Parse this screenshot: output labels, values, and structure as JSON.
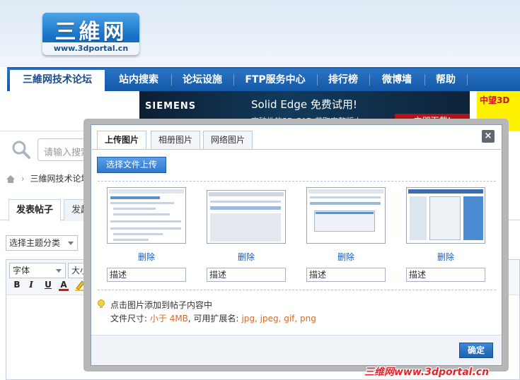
{
  "site": {
    "logo_cn": "三維网",
    "logo_url": "www.3dportal.cn"
  },
  "nav": {
    "items": [
      {
        "label": "三維网技术论坛",
        "active": true
      },
      {
        "label": "站内搜索"
      },
      {
        "label": "论坛设施"
      },
      {
        "label": "FTP服务中心"
      },
      {
        "label": "排行榜"
      },
      {
        "label": "微博墙"
      },
      {
        "label": "帮助"
      }
    ]
  },
  "banner": {
    "brand": "SIEMENS",
    "promo": "Solid Edge 免费试用!",
    "promo_sub": "突破性的3D CAD 获取完整版本",
    "cta": "立即下载!",
    "side_brand": "中望3D"
  },
  "search": {
    "placeholder": "请输入搜索"
  },
  "breadcrumb": {
    "current": "三維网技术论坛"
  },
  "post_tabs": [
    {
      "label": "发表帖子"
    },
    {
      "label": "发起"
    }
  ],
  "form": {
    "topic_select": "选择主题分类",
    "font_select": "字体",
    "size_select": "大小",
    "fmt_bold": "B",
    "fmt_italic": "I",
    "fmt_underline": "U",
    "fmt_color": "A"
  },
  "dialog": {
    "tabs": [
      {
        "label": "上传图片",
        "active": true
      },
      {
        "label": "相册图片"
      },
      {
        "label": "网络图片"
      }
    ],
    "close": "×",
    "upload_button": "选择文件上传",
    "images": [
      {
        "delete": "删除",
        "desc_placeholder": "描述"
      },
      {
        "delete": "删除",
        "desc_placeholder": "描述"
      },
      {
        "delete": "删除",
        "desc_placeholder": "描述"
      },
      {
        "delete": "删除",
        "desc_placeholder": "描述"
      }
    ],
    "tip": "点击图片添加到帖子内容中",
    "size_label": "文件尺寸:",
    "size_value": "小于 4MB",
    "ext_label": ", 可用扩展名:",
    "ext_value": "jpg, jpeg, gif, png",
    "ok": "确定"
  },
  "watermark": "三维网www.3dportal.cn",
  "colors": {
    "nav_blue": "#1359a8",
    "link_blue": "#1a5cb0",
    "highlight_orange": "#d46a2a",
    "watermark_red": "#e3262b"
  }
}
